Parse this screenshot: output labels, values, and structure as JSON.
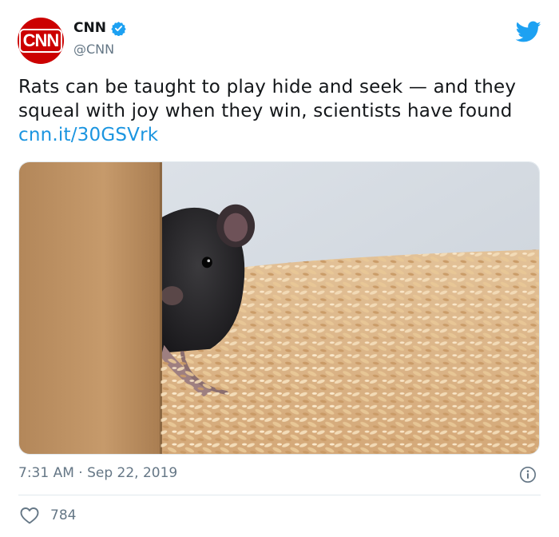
{
  "author": {
    "avatar_text": "CNN",
    "display_name": "CNN",
    "handle": "@CNN",
    "verified": true
  },
  "tweet": {
    "text": "Rats can be taught to play hide and seek — and they squeal with joy when they win, scientists have found",
    "link": "cnn.it/30GSVrk",
    "timestamp": "7:31 AM · Sep 22, 2019",
    "likes": "784"
  },
  "media": {
    "description": "rat-peeking-behind-cardboard-on-wood-shavings"
  },
  "icons": {
    "brand": "twitter-bird-icon",
    "verified": "verified-badge-icon",
    "info": "info-icon",
    "like": "heart-icon"
  },
  "colors": {
    "brand_red": "#cc0000",
    "twitter_blue": "#1da1f2",
    "link_blue": "#1b95e0",
    "secondary_text": "#657786"
  }
}
